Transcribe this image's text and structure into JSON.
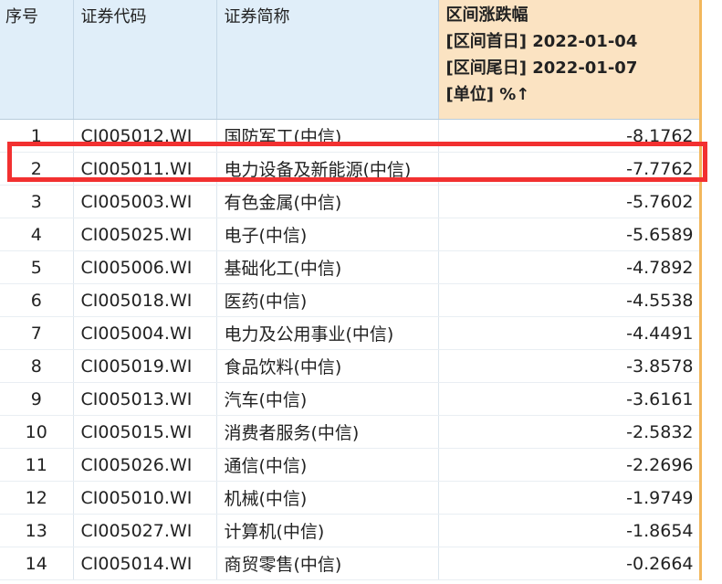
{
  "columns": {
    "seq": "序号",
    "code": "证券代码",
    "name": "证券简称",
    "change": {
      "title": "区间涨跌幅",
      "start": "[区间首日] 2022-01-04",
      "end": "[区间尾日] 2022-01-07",
      "unit": "[单位] %↑"
    }
  },
  "rows": [
    {
      "seq": "1",
      "code": "CI005012.WI",
      "name": "国防军工(中信)",
      "change": "-8.1762"
    },
    {
      "seq": "2",
      "code": "CI005011.WI",
      "name": "电力设备及新能源(中信)",
      "change": "-7.7762"
    },
    {
      "seq": "3",
      "code": "CI005003.WI",
      "name": "有色金属(中信)",
      "change": "-5.7602"
    },
    {
      "seq": "4",
      "code": "CI005025.WI",
      "name": "电子(中信)",
      "change": "-5.6589"
    },
    {
      "seq": "5",
      "code": "CI005006.WI",
      "name": "基础化工(中信)",
      "change": "-4.7892"
    },
    {
      "seq": "6",
      "code": "CI005018.WI",
      "name": "医药(中信)",
      "change": "-4.5538"
    },
    {
      "seq": "7",
      "code": "CI005004.WI",
      "name": "电力及公用事业(中信)",
      "change": "-4.4491"
    },
    {
      "seq": "8",
      "code": "CI005019.WI",
      "name": "食品饮料(中信)",
      "change": "-3.8578"
    },
    {
      "seq": "9",
      "code": "CI005013.WI",
      "name": "汽车(中信)",
      "change": "-3.6161"
    },
    {
      "seq": "10",
      "code": "CI005015.WI",
      "name": "消费者服务(中信)",
      "change": "-2.5832"
    },
    {
      "seq": "11",
      "code": "CI005026.WI",
      "name": "通信(中信)",
      "change": "-2.2696"
    },
    {
      "seq": "12",
      "code": "CI005010.WI",
      "name": "机械(中信)",
      "change": "-1.9749"
    },
    {
      "seq": "13",
      "code": "CI005027.WI",
      "name": "计算机(中信)",
      "change": "-1.8654"
    },
    {
      "seq": "14",
      "code": "CI005014.WI",
      "name": "商贸零售(中信)",
      "change": "-0.2664"
    }
  ],
  "colors": {
    "header_bg": "#e0eef9",
    "sorted_header_bg": "#fbe3c2",
    "sorted_border": "#f2b75c",
    "highlight_box": "#f23030"
  }
}
